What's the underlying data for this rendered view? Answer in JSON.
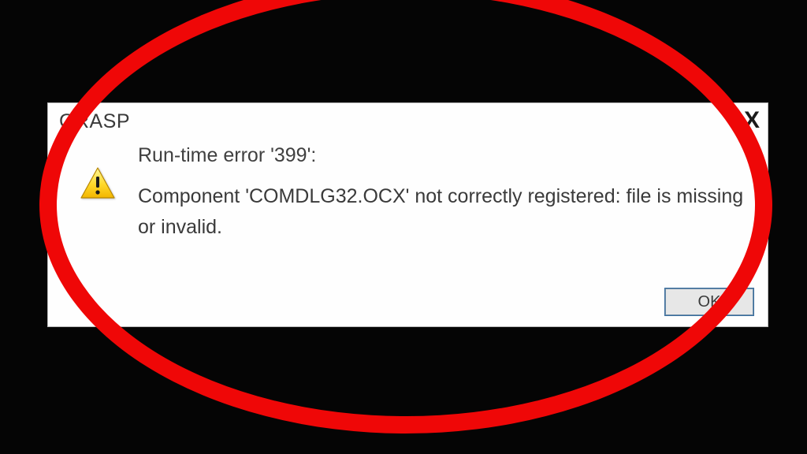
{
  "dialog": {
    "title": "GRASP",
    "close_label": "X",
    "error_heading": "Run-time error '399':",
    "error_body": "Component 'COMDLG32.OCX' not correctly  registered: file is missing or invalid.",
    "ok_label": "OK"
  },
  "annotation": {
    "ellipse_color": "#ef0707"
  }
}
